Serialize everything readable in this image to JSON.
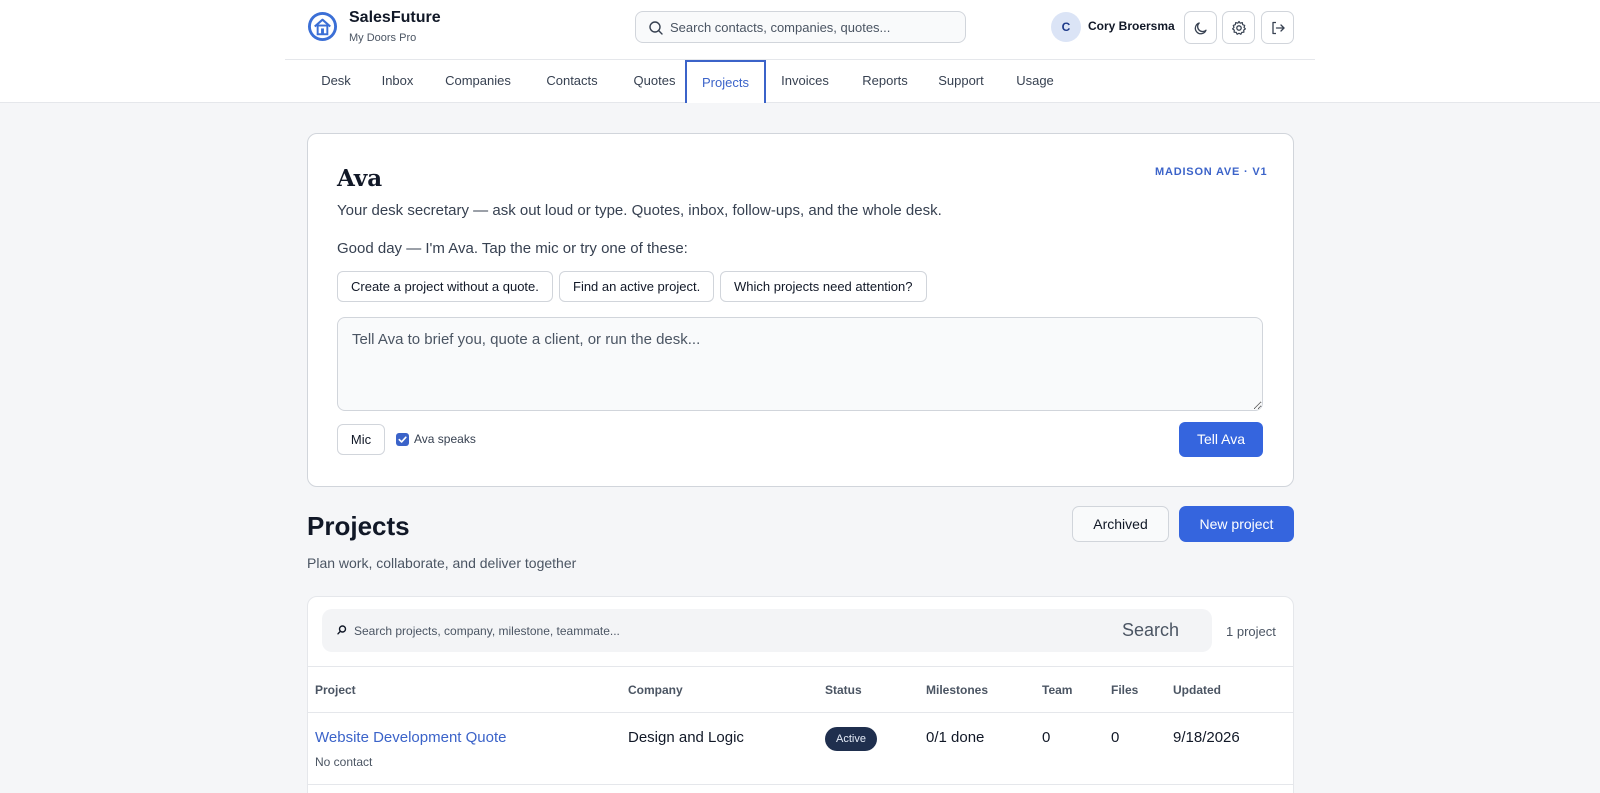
{
  "brand": {
    "name": "SalesFuture",
    "subtitle": "My Doors Pro"
  },
  "global_search": {
    "placeholder": "Search contacts, companies, quotes..."
  },
  "user": {
    "initial": "C",
    "name": "Cory Broersma"
  },
  "header_icons": [
    "moon-icon",
    "gear-icon",
    "logout-icon"
  ],
  "nav": {
    "tabs": [
      {
        "label": "Desk"
      },
      {
        "label": "Inbox"
      },
      {
        "label": "Companies"
      },
      {
        "label": "Contacts"
      },
      {
        "label": "Quotes"
      },
      {
        "label": "Projects",
        "active": true
      },
      {
        "label": "Invoices"
      },
      {
        "label": "Reports"
      },
      {
        "label": "Support"
      },
      {
        "label": "Usage"
      }
    ]
  },
  "ava": {
    "title": "Ava",
    "badge": "MADISON AVE · V1",
    "description": "Your desk secretary — ask out loud or type. Quotes, inbox, follow-ups, and the whole desk.",
    "greeting": "Good day — I'm Ava. Tap the mic or try one of these:",
    "suggestions": [
      "Create a project without a quote.",
      "Find an active project.",
      "Which projects need attention?"
    ],
    "input_placeholder": "Tell Ava to brief you, quote a client, or run the desk...",
    "input_value": "",
    "mic_label": "Mic",
    "speaks_label": "Ava speaks",
    "speaks_checked": true,
    "submit_label": "Tell Ava"
  },
  "projects": {
    "title": "Projects",
    "subtitle": "Plan work, collaborate, and deliver together",
    "archived_label": "Archived",
    "new_label": "New project",
    "search_placeholder": "Search projects, company, milestone, teammate...",
    "search_button": "Search",
    "count_label": "1 project",
    "columns": [
      "Project",
      "Company",
      "Status",
      "Milestones",
      "Team",
      "Files",
      "Updated"
    ],
    "rows": [
      {
        "project": "Website Development Quote",
        "contact": "No contact",
        "company": "Design and Logic",
        "status": "Active",
        "milestones": "0/1 done",
        "team": "0",
        "files": "0",
        "updated": "9/18/2026"
      }
    ]
  },
  "colors": {
    "accent": "#3565de",
    "link": "#3b63c9",
    "status_active_bg": "#1f2f4e",
    "page_bg": "#f5f6f8"
  }
}
